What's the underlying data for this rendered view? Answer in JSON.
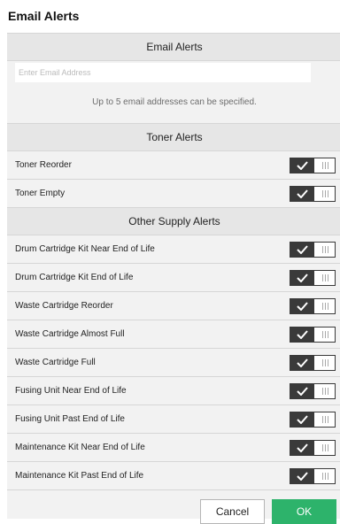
{
  "page_title": "Email Alerts",
  "email_section": {
    "header": "Email Alerts",
    "input_placeholder": "Enter Email Address",
    "input_value": "",
    "hint": "Up to 5 email addresses can be specified."
  },
  "toner_section": {
    "header": "Toner Alerts",
    "items": [
      {
        "label": "Toner Reorder",
        "enabled": true
      },
      {
        "label": "Toner Empty",
        "enabled": true
      }
    ]
  },
  "supply_section": {
    "header": "Other Supply Alerts",
    "items": [
      {
        "label": "Drum Cartridge Kit Near End of Life",
        "enabled": true
      },
      {
        "label": "Drum Cartridge Kit End of Life",
        "enabled": true
      },
      {
        "label": "Waste Cartridge Reorder",
        "enabled": true
      },
      {
        "label": "Waste Cartridge Almost Full",
        "enabled": true
      },
      {
        "label": "Waste Cartridge Full",
        "enabled": true
      },
      {
        "label": "Fusing Unit Near End of Life",
        "enabled": true
      },
      {
        "label": "Fusing Unit Past End of Life",
        "enabled": true
      },
      {
        "label": "Maintenance Kit Near End of Life",
        "enabled": true
      },
      {
        "label": "Maintenance Kit Past End of Life",
        "enabled": true
      }
    ]
  },
  "footer": {
    "cancel_label": "Cancel",
    "ok_label": "OK"
  },
  "colors": {
    "ok_button": "#2db36b",
    "toggle_on": "#3a3a3a",
    "panel_bg": "#f2f2f2",
    "header_bg": "#e6e6e6"
  },
  "icons": {
    "toggle_on_glyph": "checkmark-icon",
    "toggle_off_glyph": "grip-lines-icon"
  }
}
